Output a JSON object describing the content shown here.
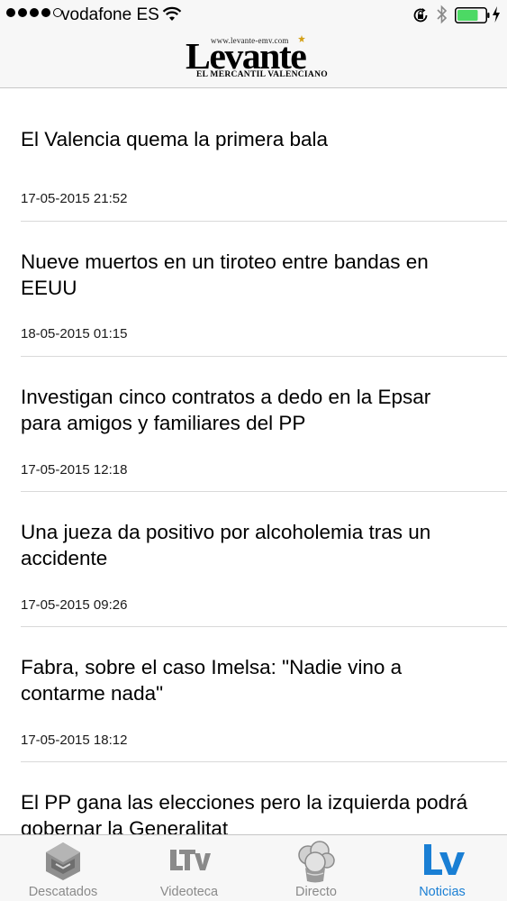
{
  "status_bar": {
    "carrier": "vodafone ES",
    "signal_bars_filled": 4,
    "signal_bars_total": 5,
    "battery_level": 0.75,
    "battery_color": "#4cd964"
  },
  "header": {
    "logo_url": "www.levante-emv.com",
    "logo_name": "Levante",
    "logo_subtitle": "EL MERCANTIL VALENCIANO"
  },
  "news": [
    {
      "title": "El Valencia quema la primera bala",
      "date": "17-05-2015 21:52"
    },
    {
      "title": "Nueve muertos en un tiroteo entre bandas en EEUU",
      "date": "18-05-2015 01:15"
    },
    {
      "title": "Investigan cinco contratos a dedo en la Epsar para amigos y familiares del PP",
      "date": "17-05-2015 12:18"
    },
    {
      "title": "Una jueza da positivo por alcoholemia tras un accidente",
      "date": "17-05-2015 09:26"
    },
    {
      "title": "Fabra, sobre el caso Imelsa: \"Nadie vino a contarme nada\"",
      "date": "17-05-2015 18:12"
    },
    {
      "title": "El PP gana las elecciones pero la izquierda podrá gobernar la Generalitat",
      "date": ""
    }
  ],
  "tabs": [
    {
      "label": "Descatados",
      "icon": "highlights-icon",
      "active": false
    },
    {
      "label": "Videoteca",
      "icon": "ltv-icon",
      "active": false
    },
    {
      "label": "Directo",
      "icon": "live-icon",
      "active": false
    },
    {
      "label": "Noticias",
      "icon": "lv-icon",
      "active": true
    }
  ],
  "colors": {
    "accent": "#1a7fd4",
    "inactive": "#8a8a8a"
  }
}
